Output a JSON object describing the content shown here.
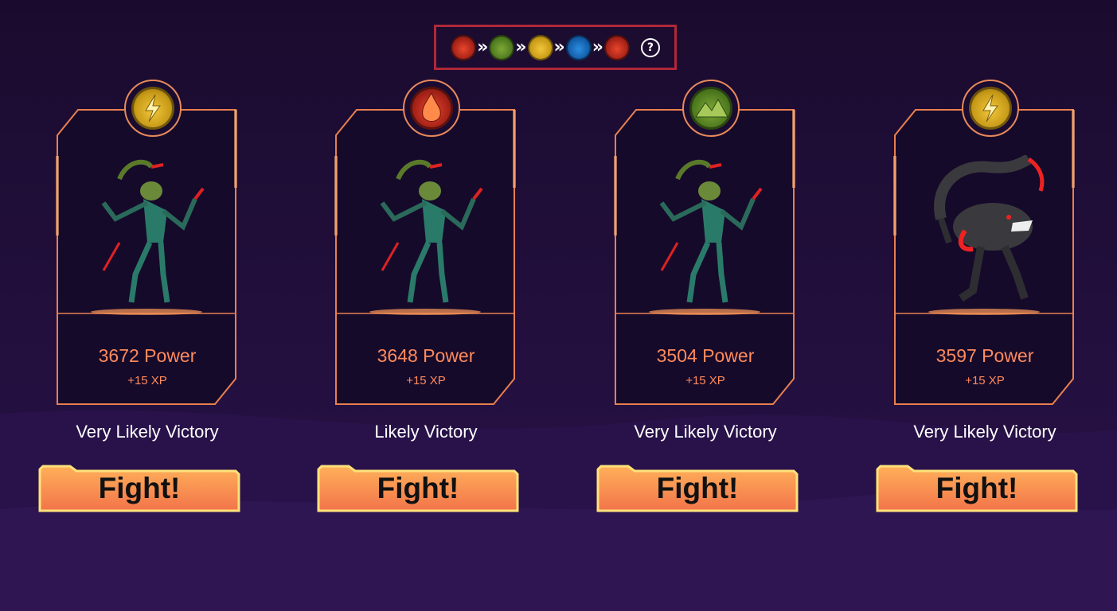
{
  "element_cycle": {
    "elements": [
      "fire",
      "earth",
      "life",
      "water",
      "fire"
    ],
    "separator": "»",
    "help_label": "?"
  },
  "colors": {
    "accent_orange": "#ff8a5c",
    "frame_orange": "#e8804f",
    "highlight_red": "#b0283a",
    "button_gold": "#ffd35a"
  },
  "opponents": [
    {
      "element": "life",
      "element_icon": "lightning-icon",
      "monster": "mantis-creature",
      "power": "3672 Power",
      "xp": "+15 XP",
      "odds": "Very Likely Victory",
      "fight_label": "Fight!"
    },
    {
      "element": "fire",
      "element_icon": "flame-icon",
      "monster": "mantis-creature",
      "power": "3648 Power",
      "xp": "+15 XP",
      "odds": "Likely Victory",
      "fight_label": "Fight!"
    },
    {
      "element": "earth",
      "element_icon": "mountain-icon",
      "monster": "mantis-creature",
      "power": "3504 Power",
      "xp": "+15 XP",
      "odds": "Very Likely Victory",
      "fight_label": "Fight!"
    },
    {
      "element": "life",
      "element_icon": "lightning-icon",
      "monster": "scorpion-creature",
      "power": "3597 Power",
      "xp": "+15 XP",
      "odds": "Very Likely Victory",
      "fight_label": "Fight!"
    }
  ]
}
